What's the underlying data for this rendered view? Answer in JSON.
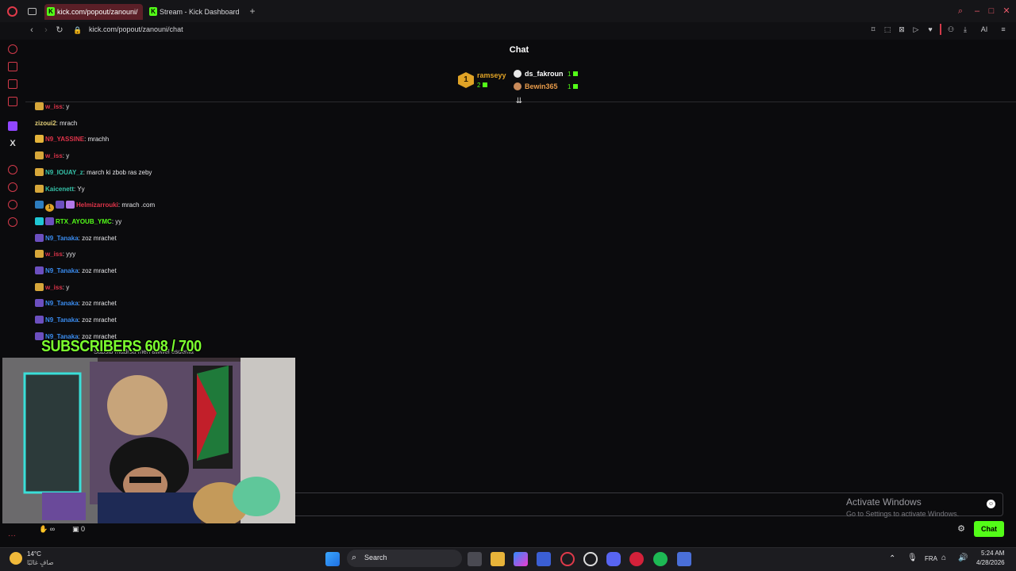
{
  "browser": {
    "tabs": [
      {
        "label": "kick.com/popout/zanouni/"
      },
      {
        "label": "Stream - Kick Dashboard"
      }
    ],
    "url": "kick.com/popout/zanouni/chat",
    "ai_label": "AI"
  },
  "chat": {
    "title": "Chat",
    "top_gifters": [
      {
        "rank": "1",
        "name": "ramseyy",
        "count": "2",
        "color": "#e0a326"
      },
      {
        "name": "ds_fakroun",
        "count": "1",
        "color": "#ffffff"
      },
      {
        "name": "Bewin365",
        "count": "1",
        "color": "#e89b4a"
      }
    ],
    "messages": [
      {
        "user": "w_iss",
        "text": ": y",
        "color": "#e0344a",
        "badges": [
          "gold"
        ]
      },
      {
        "user": "zizoui2",
        "text": ": mrach",
        "color": "#e6d27a",
        "badges": []
      },
      {
        "user": "N9_YASSINE",
        "text": ": mrachh",
        "color": "#e0344a",
        "badges": [
          "crown"
        ]
      },
      {
        "user": "w_iss",
        "text": ": y",
        "color": "#e0344a",
        "badges": [
          "gold"
        ]
      },
      {
        "user": "N9_IOUAY_z",
        "text": ": march ki zbob ras zeby",
        "color": "#35c2a8",
        "badges": [
          "gold"
        ]
      },
      {
        "user": "Kaicenett",
        "text": ": Yy",
        "color": "#35c2a8",
        "badges": [
          "gold"
        ]
      },
      {
        "user": "Helmizarrouki",
        "text": ": mrach .com",
        "color": "#e0344a",
        "badges": [
          "blue",
          "round",
          "purple",
          "pink"
        ],
        "round_label": "1"
      },
      {
        "user": "RTX_AYOUB_YMC",
        "text": ": yy",
        "color": "#53fc18",
        "badges": [
          "cyan",
          "purple"
        ]
      },
      {
        "user": "N9_Tanaka",
        "text": ": zoz mrachet",
        "color": "#3a8cf0",
        "badges": [
          "purple"
        ]
      },
      {
        "user": "w_iss",
        "text": ": yyy",
        "color": "#e0344a",
        "badges": [
          "gold"
        ]
      },
      {
        "user": "N9_Tanaka",
        "text": ": zoz mrachet",
        "color": "#3a8cf0",
        "badges": [
          "purple"
        ]
      },
      {
        "user": "w_iss",
        "text": ": y",
        "color": "#e0344a",
        "badges": [
          "gold"
        ]
      },
      {
        "user": "N9_Tanaka",
        "text": ": zoz mrachet",
        "color": "#3a8cf0",
        "badges": [
          "purple"
        ]
      },
      {
        "user": "N9_Tanaka",
        "text": ": zoz mrachet",
        "color": "#3a8cf0",
        "badges": [
          "purple"
        ]
      },
      {
        "user": "N9_Tanaka",
        "text": ": zoz mrachet",
        "color": "#3a8cf0",
        "badges": [
          "purple"
        ]
      }
    ],
    "overlay_goal": "SUBSCRIBERS 608 / 700",
    "partial_line": "Sabsib madrsa men awwel esdenia",
    "send_label": "Chat",
    "viewers_icon_label": "∞",
    "points": "0",
    "watermark": {
      "line1": "Activate Windows",
      "line2": "Go to Settings to activate Windows."
    }
  },
  "taskbar": {
    "weather_temp": "14°C",
    "weather_desc": "صافٍ غالبًا",
    "search_label": "Search",
    "language": "FRA",
    "time": "5:24 AM",
    "date": "4/28/2026"
  },
  "colors": {
    "kick_green": "#53fc18",
    "opera_red": "#d23a4a",
    "background": "#0b0b0d"
  }
}
